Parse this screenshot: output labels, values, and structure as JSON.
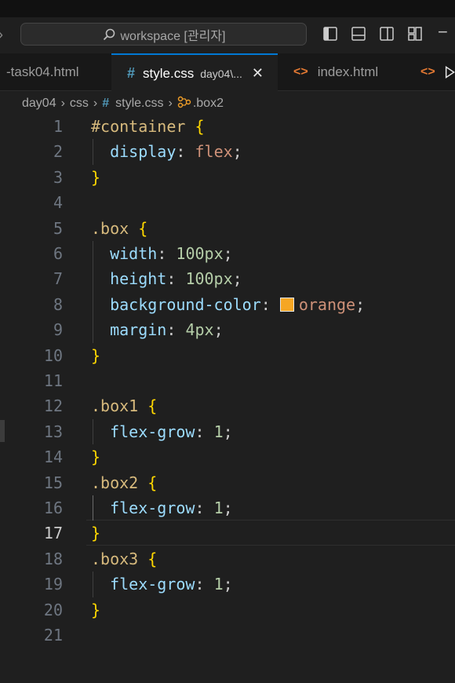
{
  "title_bar": {
    "search_text": "workspace [관리자]"
  },
  "tabs": [
    {
      "label": "-task04.html",
      "active": false
    },
    {
      "label": "style.css",
      "description": "day04\\...",
      "active": true
    },
    {
      "label": "index.html",
      "active": false
    }
  ],
  "breadcrumb": {
    "folder1": "day04",
    "folder2": "css",
    "file": "style.css",
    "symbol": ".box2"
  },
  "editor": {
    "current_line": 17,
    "color_swatch": "#f5a623",
    "lines": [
      {
        "n": "1",
        "sel": "#container",
        "brace": "{"
      },
      {
        "n": "2",
        "prop": "display",
        "value": "flex",
        "vtype": "val"
      },
      {
        "n": "3",
        "close": "}"
      },
      {
        "n": "4"
      },
      {
        "n": "5",
        "sel": ".box",
        "brace": "{"
      },
      {
        "n": "6",
        "prop": "width",
        "value": "100px",
        "vtype": "num"
      },
      {
        "n": "7",
        "prop": "height",
        "value": "100px",
        "vtype": "num"
      },
      {
        "n": "8",
        "prop": "background-color",
        "value": "orange",
        "vtype": "val",
        "swatch": true
      },
      {
        "n": "9",
        "prop": "margin",
        "value": "4px",
        "vtype": "num"
      },
      {
        "n": "10",
        "close": "}"
      },
      {
        "n": "11"
      },
      {
        "n": "12",
        "sel": ".box1",
        "brace": "{"
      },
      {
        "n": "13",
        "prop": "flex-grow",
        "value": "1",
        "vtype": "num"
      },
      {
        "n": "14",
        "close": "}"
      },
      {
        "n": "15",
        "sel": ".box2",
        "brace": "{"
      },
      {
        "n": "16",
        "prop": "flex-grow",
        "value": "1",
        "vtype": "num"
      },
      {
        "n": "17",
        "close": "}"
      },
      {
        "n": "18",
        "sel": ".box3",
        "brace": "{"
      },
      {
        "n": "19",
        "prop": "flex-grow",
        "value": "1",
        "vtype": "num"
      },
      {
        "n": "20",
        "close": "}"
      },
      {
        "n": "21"
      }
    ]
  }
}
